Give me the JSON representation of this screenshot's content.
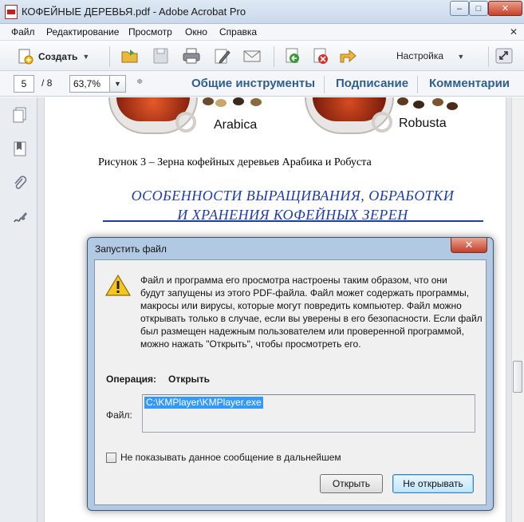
{
  "window": {
    "title": "КОФЕЙНЫЕ ДЕРЕВЬЯ.pdf - Adobe Acrobat Pro",
    "minimize": "–",
    "maximize": "□",
    "close": "✕"
  },
  "menu": {
    "items": [
      "Файл",
      "Редактирование",
      "Просмотр",
      "Окно",
      "Справка"
    ],
    "doc_close": "✕"
  },
  "toolbar": {
    "create_label": "Создать",
    "settings_label": "Настройка",
    "icons": [
      "open-folder-icon",
      "save-icon",
      "print-icon",
      "edit-icon",
      "email-icon",
      "back-green-icon",
      "stop-red-icon",
      "forward-icon",
      "expand-icon"
    ]
  },
  "nav": {
    "page_current": "5",
    "page_sep": "/",
    "page_total": "8",
    "zoom": "63,7%",
    "links": [
      "Общие инструменты",
      "Подписание",
      "Комментарии"
    ]
  },
  "document": {
    "cup_left_label": "Arabica",
    "cup_right_label": "Robusta",
    "caption": "Рисунок 3 – Зерна кофейных деревьев  Арабика и Робуста",
    "heading_line1": "ОСОБЕННОСТИ ВЫРАЩИВАНИЯ, ОБРАБОТКИ",
    "heading_line2": "И ХРАНЕНИЯ КОФЕЙНЫХ ЗЕРЕН"
  },
  "dialog": {
    "title": "Запустить файл",
    "close": "✕",
    "message": "Файл и программа его просмотра настроены таким образом, что они\nбудут запущены из этого PDF-файла. Файл может содержать программы,\nмакросы или вирусы, которые могут повредить компьютер. Файл можно\nоткрывать только в случае, если вы уверены в его безопасности. Если файл\nбыл размещен надежным пользователем или проверенной программой,\nможно нажать \"Открыть\", чтобы просмотреть его.",
    "operation_label": "Операция:",
    "operation_value": "Открыть",
    "file_label": "Файл:",
    "file_path": "C:\\KMPlayer\\KMPlayer.exe",
    "checkbox_label": "Не показывать данное сообщение в дальнейшем",
    "checkbox_checked": false,
    "open_button": "Открыть",
    "dont_open_button": "Не открывать"
  },
  "colors": {
    "accent_link": "#2f5f8f",
    "heading_blue": "#1c3cb0",
    "selection": "#3399ff"
  }
}
